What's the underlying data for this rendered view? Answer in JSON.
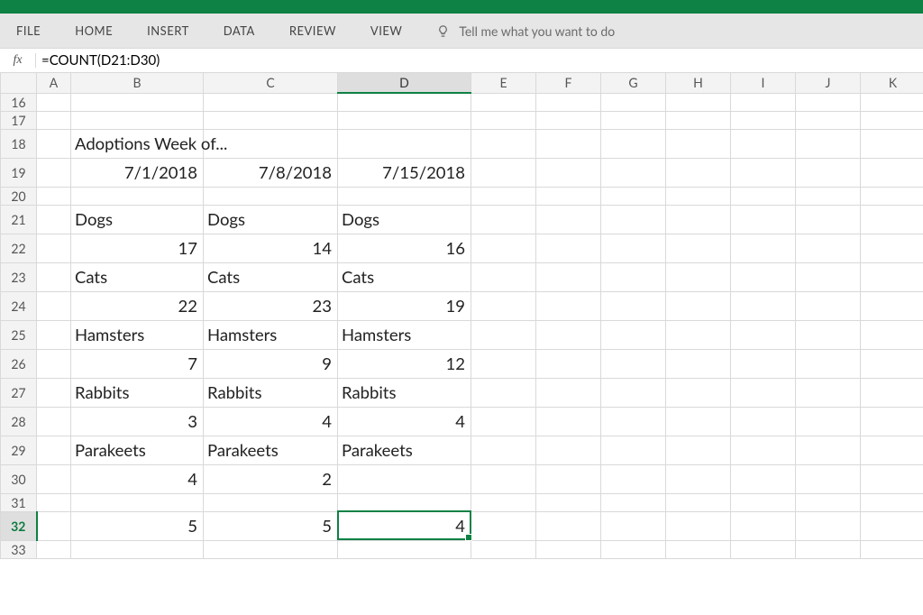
{
  "ribbon": {
    "file": "FILE",
    "home": "HOME",
    "insert": "INSERT",
    "data": "DATA",
    "review": "REVIEW",
    "view": "VIEW",
    "tellme": "Tell me what you want to do"
  },
  "fx": {
    "label": "fx",
    "value": "=COUNT(D21:D30)"
  },
  "columns": [
    "A",
    "B",
    "C",
    "D",
    "E",
    "F",
    "G",
    "H",
    "I",
    "J",
    "K"
  ],
  "row_start": 16,
  "row_end": 33,
  "big_rows": [
    18,
    19,
    21,
    22,
    23,
    24,
    25,
    26,
    27,
    28,
    29,
    30,
    32
  ],
  "selected_col": "D",
  "selected_row": 32,
  "cells": {
    "B18": {
      "v": "Adoptions Week of...",
      "a": "l"
    },
    "B19": {
      "v": "7/1/2018",
      "a": "r"
    },
    "C19": {
      "v": "7/8/2018",
      "a": "r"
    },
    "D19": {
      "v": "7/15/2018",
      "a": "r"
    },
    "B21": {
      "v": "Dogs",
      "a": "l"
    },
    "C21": {
      "v": "Dogs",
      "a": "l"
    },
    "D21": {
      "v": "Dogs",
      "a": "l"
    },
    "B22": {
      "v": "17",
      "a": "r"
    },
    "C22": {
      "v": "14",
      "a": "r"
    },
    "D22": {
      "v": "16",
      "a": "r"
    },
    "B23": {
      "v": "Cats",
      "a": "l"
    },
    "C23": {
      "v": "Cats",
      "a": "l"
    },
    "D23": {
      "v": "Cats",
      "a": "l"
    },
    "B24": {
      "v": "22",
      "a": "r"
    },
    "C24": {
      "v": "23",
      "a": "r"
    },
    "D24": {
      "v": "19",
      "a": "r"
    },
    "B25": {
      "v": "Hamsters",
      "a": "l"
    },
    "C25": {
      "v": "Hamsters",
      "a": "l"
    },
    "D25": {
      "v": "Hamsters",
      "a": "l"
    },
    "B26": {
      "v": "7",
      "a": "r"
    },
    "C26": {
      "v": "9",
      "a": "r"
    },
    "D26": {
      "v": "12",
      "a": "r"
    },
    "B27": {
      "v": "Rabbits",
      "a": "l"
    },
    "C27": {
      "v": "Rabbits",
      "a": "l"
    },
    "D27": {
      "v": "Rabbits",
      "a": "l"
    },
    "B28": {
      "v": "3",
      "a": "r"
    },
    "C28": {
      "v": "4",
      "a": "r"
    },
    "D28": {
      "v": "4",
      "a": "r"
    },
    "B29": {
      "v": "Parakeets",
      "a": "l"
    },
    "C29": {
      "v": "Parakeets",
      "a": "l"
    },
    "D29": {
      "v": "Parakeets",
      "a": "l"
    },
    "B30": {
      "v": "4",
      "a": "r"
    },
    "C30": {
      "v": "2",
      "a": "r"
    },
    "B32": {
      "v": "5",
      "a": "r"
    },
    "C32": {
      "v": "5",
      "a": "r"
    },
    "D32": {
      "v": "4",
      "a": "r"
    }
  }
}
